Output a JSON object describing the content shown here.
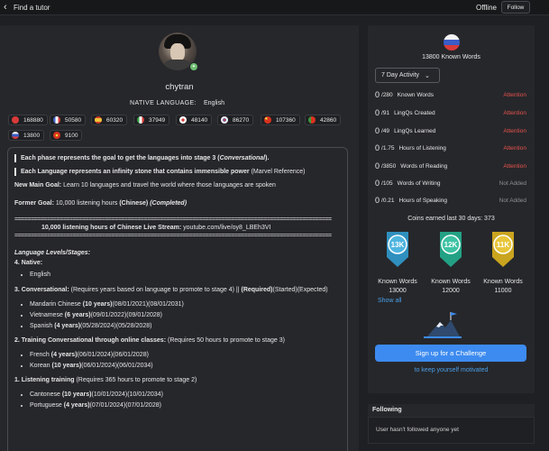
{
  "topbar": {
    "title": "Find a tutor",
    "status": "Offline",
    "follow_label": "Follow"
  },
  "profile": {
    "username": "chytran",
    "native_label": "NATIVE LANGUAGE:",
    "native_value": "English"
  },
  "language_chips": [
    {
      "flag": "hk-flag",
      "value": "168880",
      "color": "#d83a3a"
    },
    {
      "flag": "fr-flag",
      "value": "50580",
      "color": "#3d62c9"
    },
    {
      "flag": "es-flag",
      "value": "60320",
      "color": "#d43d2a"
    },
    {
      "flag": "it-flag",
      "value": "37949",
      "color": "#38a04a"
    },
    {
      "flag": "jp-flag",
      "value": "48140",
      "color": "#ffffff"
    },
    {
      "flag": "kr-flag",
      "value": "86270",
      "color": "#d0d0d0"
    },
    {
      "flag": "cn-flag",
      "value": "107360",
      "color": "#d8321f"
    },
    {
      "flag": "pt-flag",
      "value": "42860",
      "color": "#3c9a3b"
    },
    {
      "flag": "ru-flag",
      "value": "13800",
      "color": "#e8e8e8"
    },
    {
      "flag": "vn-flag",
      "value": "9100",
      "color": "#d8321f"
    }
  ],
  "bio": {
    "q1_a": "Each phase represents the goal to get the languages into stage 3 (",
    "q1_b": "Conversational",
    "q1_c": ").",
    "q2_a": "Each Language represents an infinity stone that contains immensible power",
    "q2_b": " (Marvel Reference)",
    "main_goal_label": "New Main Goal:",
    "main_goal_text": " Learn 10 languages and travel the world where those languages are spoken",
    "former_label": "Former Goal:",
    "former_text": " 10,000 listening hours ",
    "former_chinese": "(Chinese)",
    "former_completed": "(Completed)",
    "rule": "==================================================================================================",
    "stream_bold": "10,000 listening hours of Chinese Live Stream:",
    "stream_link": " youtube.com/live/oy8_LBEh3VI",
    "levels_heading": "Language Levels/Stages:",
    "native_heading": "4. Native:",
    "native_item": "English",
    "conv_heading": "3. Conversational:",
    "conv_text": " (Requires years based on language to promote to stage 4) || ",
    "conv_required": "(Required)",
    "conv_text2": "(Started)(Expected)",
    "conv_items": [
      {
        "name": "Mandarin Chinese ",
        "years": "(10 years)",
        "dates": "(08/01/2021)(08/01/2031)"
      },
      {
        "name": "Vietnamese ",
        "years": "(6 years)",
        "dates": "(09/01/2022)(09/01/2028)"
      },
      {
        "name": "Spanish ",
        "years": "(4 years)",
        "dates": "(05/28/2024)(05/28/2028)"
      }
    ],
    "training_heading": "2. Training Conversational through online classes:",
    "training_text": " (Requires 50 hours to promote to stage 3)",
    "training_items": [
      {
        "name": "French ",
        "years": "(4 years)",
        "dates": "(06/01/2024)(06/01/2028)"
      },
      {
        "name": "Korean ",
        "years": "(10 years)",
        "dates": "(06/01/2024)(06/01/2034)"
      }
    ],
    "listening_heading": "1. Listening training",
    "listening_text": " (Requires 365 hours to promote to stage 2)",
    "listening_items": [
      {
        "name": "Cantonese ",
        "years": "(10 years)",
        "dates": "(10/01/2024)(10/01/2034)"
      },
      {
        "name": "Portuguese ",
        "years": "(4 years)",
        "dates": "(07/01/2024)(07/01/2028)"
      }
    ]
  },
  "stats_panel": {
    "known_words_title": "13800 Known Words",
    "activity_select": "7 Day Activity",
    "rows": [
      {
        "num": "0",
        "total": "/280",
        "label": "Known Words",
        "status": "Attention"
      },
      {
        "num": "0",
        "total": "/91",
        "label": "LingQs Created",
        "status": "Attention"
      },
      {
        "num": "0",
        "total": "/49",
        "label": "LingQs Learned",
        "status": "Attention"
      },
      {
        "num": "0",
        "total": "/1.75",
        "label": "Hours of Listening",
        "status": "Attention"
      },
      {
        "num": "0",
        "total": "/3850",
        "label": "Words of Reading",
        "status": "Attention"
      },
      {
        "num": "0",
        "total": "/105",
        "label": "Words of Writing",
        "status": "Not Added"
      },
      {
        "num": "0",
        "total": "/0.21",
        "label": "Hours of Speaking",
        "status": "Not Added"
      }
    ],
    "coins": "Coins earned last 30 days: 373",
    "badges": [
      {
        "label": "13K",
        "color": "#4fb5e0",
        "kw_label": "Known Words",
        "kw_value": "13000"
      },
      {
        "label": "12K",
        "color": "#3fc3a4",
        "kw_label": "Known Words",
        "kw_value": "12000"
      },
      {
        "label": "11K",
        "color": "#e8c63a",
        "kw_label": "Known Words",
        "kw_value": "11000"
      }
    ],
    "show_all": "Show all",
    "challenge_button": "Sign up for a Challenge",
    "motivated_link": "to keep yourself motivated"
  },
  "following": {
    "title": "Following",
    "empty": "User hasn't followed anyone yet"
  }
}
